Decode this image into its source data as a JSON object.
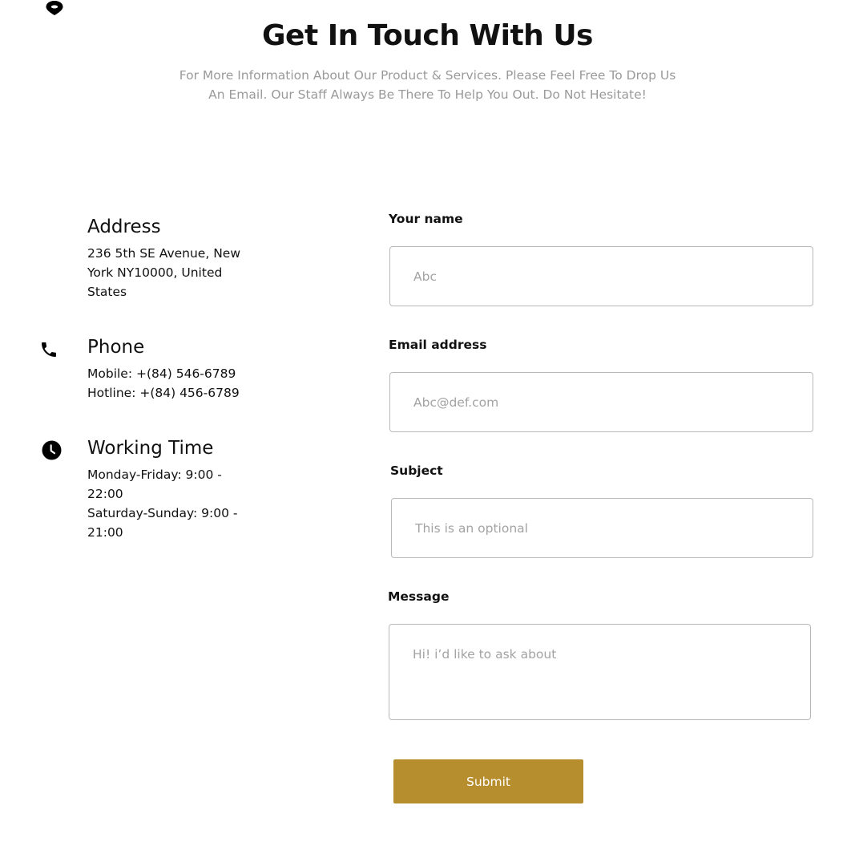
{
  "header": {
    "title": "Get In Touch With Us",
    "subtitle_line1": "For More Information About Our Product & Services. Please Feel Free To Drop Us",
    "subtitle_line2": "An Email. Our Staff Always Be There To Help You Out. Do Not Hesitate!",
    "location_icon": "location-pin-icon"
  },
  "contact_info": {
    "address": {
      "heading": "Address",
      "lines": [
        "236 5th SE Avenue, New",
        "York NY10000, United",
        "States"
      ]
    },
    "phone": {
      "icon": "phone-icon",
      "heading": "Phone",
      "lines": [
        "Mobile: +(84) 546-6789",
        "Hotline: +(84) 456-6789"
      ]
    },
    "working_time": {
      "icon": "clock-icon",
      "heading": "Working Time",
      "lines": [
        "Monday-Friday: 9:00 -",
        "22:00",
        "Saturday-Sunday: 9:00 -",
        "21:00"
      ]
    }
  },
  "form": {
    "name": {
      "label": "Your name",
      "value": "",
      "placeholder": "Abc"
    },
    "email": {
      "label": "Email address",
      "value": "",
      "placeholder": "Abc@def.com"
    },
    "subject": {
      "label": "Subject",
      "value": "",
      "placeholder": "This is an optional"
    },
    "message": {
      "label": "Message",
      "value": "",
      "placeholder": "Hi! i’d like to ask about"
    },
    "submit_label": "Submit"
  },
  "colors": {
    "accent": "#b78e2d",
    "subtitle": "#9a9a9a",
    "border": "#b9b9b9",
    "placeholder": "#a3a3a3"
  }
}
